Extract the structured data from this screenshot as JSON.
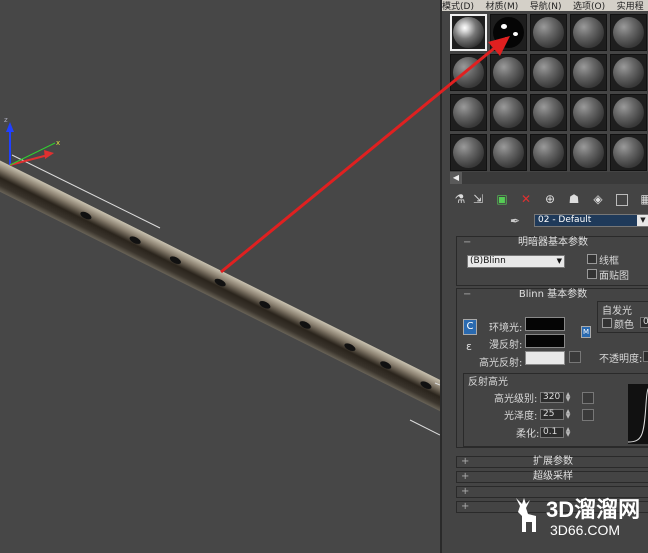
{
  "colors": {
    "viewport_bg": "#474747",
    "arrow": "#e02020",
    "name_field_bg": "#1f3a5a"
  },
  "menubar": {
    "items": [
      "模式(D)",
      "材质(M)",
      "导航(N)",
      "选项(O)",
      "实用程"
    ]
  },
  "material_slots": {
    "selected_slot": 1,
    "active_slot": 2
  },
  "toolbar": {
    "icons": [
      "get-material-icon",
      "put-to-scene-icon",
      "assign-material-icon",
      "reset-map-icon",
      "make-unique-icon",
      "put-to-library-icon",
      "material-id-icon",
      "show-map-icon",
      "background-icon"
    ]
  },
  "material_name": {
    "value": "02 - Default"
  },
  "shader_rollout": {
    "title": "明暗器基本参数",
    "shader": "(B)Blinn",
    "wire_label": "线框",
    "faceted_label": "面贴图"
  },
  "blinn_rollout": {
    "title": "Blinn 基本参数",
    "self_illum_label": "自发光",
    "color_label": "颜色",
    "color_value": "0",
    "ambient_label": "环境光:",
    "diffuse_label": "漫反射:",
    "specular_label": "高光反射:",
    "opacity_label": "不透明度:",
    "lock_label": "C",
    "map_label": "ɛ",
    "specular_highlights": {
      "title": "反射高光",
      "level_label": "高光级别:",
      "level_value": "320",
      "gloss_label": "光泽度:",
      "gloss_value": "25",
      "soften_label": "柔化:",
      "soften_value": "0.1"
    }
  },
  "collapsed_rollouts": [
    "扩展参数",
    "超级采样",
    "",
    ""
  ],
  "watermark": {
    "brand": "3D溜溜网",
    "url": "3D66.COM"
  }
}
